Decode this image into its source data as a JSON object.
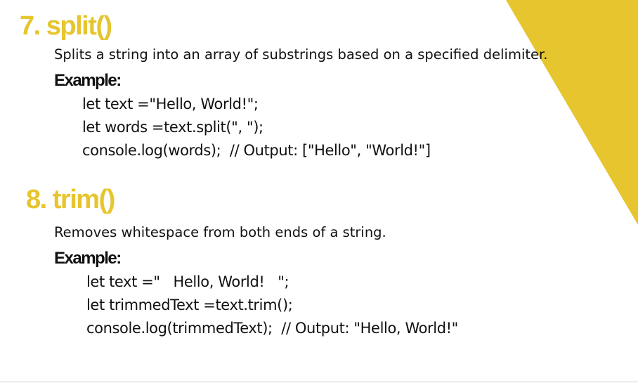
{
  "theme": {
    "accent": "#E6C52E",
    "text": "#111111"
  },
  "sections": [
    {
      "heading": "7. split()",
      "description": "Splits a string into an array of substrings based on a specified delimiter.",
      "example_label": "Example:",
      "code": [
        "let text =\"Hello, World!\";",
        "let words =text.split(\", \");",
        "console.log(words);  // Output: [\"Hello\", \"World!\"]"
      ]
    },
    {
      "heading": "8. trim()",
      "description": "Removes whitespace from both ends of a string.",
      "example_label": "Example:",
      "code": [
        "let text =\"   Hello, World!   \";",
        "let trimmedText =text.trim();",
        "console.log(trimmedText);  // Output: \"Hello, World!\""
      ]
    }
  ]
}
